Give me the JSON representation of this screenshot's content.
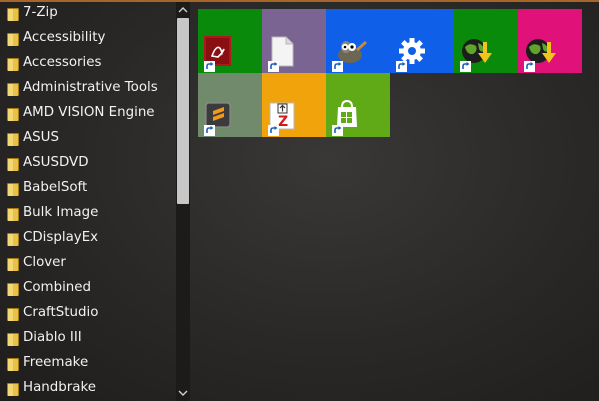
{
  "start_menu": {
    "folders": [
      {
        "label": "7-Zip"
      },
      {
        "label": "Accessibility"
      },
      {
        "label": "Accessories"
      },
      {
        "label": "Administrative Tools"
      },
      {
        "label": "AMD VISION Engine"
      },
      {
        "label": "ASUS"
      },
      {
        "label": "ASUSDVD"
      },
      {
        "label": "BabelSoft"
      },
      {
        "label": "Bulk Image"
      },
      {
        "label": "CDisplayEx"
      },
      {
        "label": "Clover"
      },
      {
        "label": "Combined"
      },
      {
        "label": "CraftStudio"
      },
      {
        "label": "Diablo III"
      },
      {
        "label": "Freemake"
      },
      {
        "label": "Handbrake"
      }
    ]
  },
  "tiles": [
    {
      "icon": "acrobat-reader-icon",
      "color": "#0a8a0a"
    },
    {
      "icon": "document-icon",
      "color": "#7a6592"
    },
    {
      "icon": "gimp-icon",
      "color": "#0f5fe8"
    },
    {
      "icon": "settings-gear-icon",
      "color": "#0f5fe8"
    },
    {
      "icon": "globe-download-icon",
      "color": "#0a8a0a"
    },
    {
      "icon": "globe-download-icon",
      "color": "#e0127a"
    },
    {
      "icon": "sublime-text-icon",
      "color": "#728a6c"
    },
    {
      "icon": "zip-archive-icon",
      "color": "#f0a30a"
    },
    {
      "icon": "store-bag-icon",
      "color": "#60a917"
    }
  ],
  "colors": {
    "accent_edge": "#a8652a",
    "text": "#f2f2f2",
    "scroll_thumb": "#c7c7c7"
  }
}
